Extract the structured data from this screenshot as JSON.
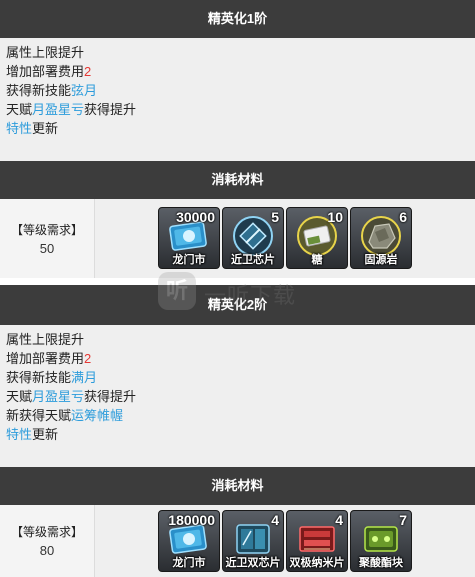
{
  "sections": [
    {
      "title": "精英化1阶",
      "desc": [
        {
          "parts": [
            {
              "t": "属性上限提升"
            }
          ]
        },
        {
          "parts": [
            {
              "t": "增加部署费用"
            },
            {
              "t": "2",
              "c": "red"
            }
          ]
        },
        {
          "parts": [
            {
              "t": "获得新技能"
            },
            {
              "t": "弦月",
              "c": "blue"
            }
          ]
        },
        {
          "parts": [
            {
              "t": "天赋"
            },
            {
              "t": "月盈星亏",
              "c": "blue"
            },
            {
              "t": "获得提升"
            }
          ]
        },
        {
          "parts": [
            {
              "t": "特性",
              "c": "blue"
            },
            {
              "t": "更新"
            }
          ]
        }
      ],
      "materials_title": "消耗材料",
      "req_label": "【等级需求】",
      "req_value": "50",
      "items": [
        {
          "count": "30000",
          "name": "龙门市",
          "icon": "lmd-icon"
        },
        {
          "count": "5",
          "name": "近卫芯片",
          "icon": "guard-chip-icon"
        },
        {
          "count": "10",
          "name": "糖",
          "icon": "sugar-icon"
        },
        {
          "count": "6",
          "name": "固源岩",
          "icon": "orirock-icon"
        }
      ]
    },
    {
      "title": "精英化2阶",
      "desc": [
        {
          "parts": [
            {
              "t": "属性上限提升"
            }
          ]
        },
        {
          "parts": [
            {
              "t": "增加部署费用"
            },
            {
              "t": "2",
              "c": "red"
            }
          ]
        },
        {
          "parts": [
            {
              "t": "获得新技能"
            },
            {
              "t": "满月",
              "c": "blue"
            }
          ]
        },
        {
          "parts": [
            {
              "t": "天赋"
            },
            {
              "t": "月盈星亏",
              "c": "blue"
            },
            {
              "t": "获得提升"
            }
          ]
        },
        {
          "parts": [
            {
              "t": "新获得天赋"
            },
            {
              "t": "运筹帷幄",
              "c": "blue"
            }
          ]
        },
        {
          "parts": [
            {
              "t": "特性",
              "c": "blue"
            },
            {
              "t": "更新"
            }
          ]
        }
      ],
      "materials_title": "消耗材料",
      "req_label": "【等级需求】",
      "req_value": "80",
      "items": [
        {
          "count": "180000",
          "name": "龙门市",
          "icon": "lmd-icon"
        },
        {
          "count": "4",
          "name": "近卫双芯片",
          "icon": "guard-dualchip-icon"
        },
        {
          "count": "4",
          "name": "双极纳米片",
          "icon": "bipolar-nanoflake-icon"
        },
        {
          "count": "7",
          "name": "聚酸酯块",
          "icon": "polyester-block-icon"
        }
      ]
    }
  ],
  "watermark": {
    "glyph": "听",
    "text": "一听下载"
  },
  "colors": {
    "header": "#3c3c3c",
    "highlight": "#2d9cdb",
    "cost": "#e53935"
  }
}
